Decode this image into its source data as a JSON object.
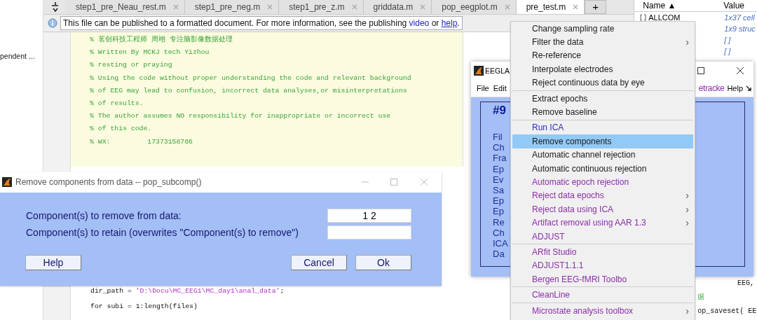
{
  "left_panel": {
    "item": "pendent ..."
  },
  "editor": {
    "tabs": [
      {
        "label": "step1_pre_Neau_rest.m",
        "selected": false
      },
      {
        "label": "step1_pre_neg.m",
        "selected": false
      },
      {
        "label": "step1_pre_z.m",
        "selected": false
      },
      {
        "label": "griddata.m",
        "selected": false
      },
      {
        "label": "pop_eegplot.m",
        "selected": false
      },
      {
        "label": "pre_test.m",
        "selected": true
      }
    ],
    "add_tab": "+",
    "info_bar": {
      "text": "This file can be published to a formatted document. For more information, see the publishing ",
      "link_1": "video",
      "middle": " or ",
      "link_2": "help",
      "end": "."
    },
    "comment_lines": [
      "% 茗创科技工程师 周翊 专注脑影像数据处理",
      "% Written By MCKJ tech Yizhou",
      "% resting or praying",
      "% Using the code without proper understanding the code and relevant background",
      "% of EEG may lead to confusion, incorrect data analyses,or misinterpretations",
      "% of results.",
      "% The author assumes NO responsibility for inappropriate or incorrect use",
      "% of this code.",
      "% WX:         17373158786"
    ],
    "code_lines": [
      {
        "text": "dir_path = ",
        "string": "'D:\\Docu\\MC_EEG1\\MC_day1\\anal_data'",
        "end": ";"
      },
      {
        "text": "for subi = 1:length(files)"
      }
    ]
  },
  "workspace": {
    "columns": [
      "Name ▲",
      "Value"
    ],
    "rows": [
      {
        "name": "ALLCOM",
        "value": "1x37 cell"
      },
      {
        "name": "",
        "value": "1x9 struc"
      },
      {
        "name": "",
        "value": "[ ]"
      },
      {
        "name": "",
        "value": "[ ]"
      }
    ]
  },
  "side_code": [
    "EEG,",
    "据",
    "op_saveset( EE"
  ],
  "eeglab": {
    "title": "EEGLA",
    "menus": [
      {
        "label": "File",
        "color": "#000000"
      },
      {
        "label": "Edit",
        "color": "#000000"
      },
      {
        "label": "etracke",
        "color": "#8b2fa8"
      },
      {
        "label": "Help",
        "color": "#000000"
      }
    ],
    "heading": "#9",
    "fields": [
      "Fil",
      "Ch",
      "Fra",
      "Ep",
      "Ev",
      "Sa",
      "Ep",
      "Ep",
      "Re",
      "Ch",
      "ICA",
      "Da"
    ]
  },
  "menu": [
    [
      {
        "label": "Change sampling rate",
        "color": "#1a1a1a",
        "submenu": false,
        "selected": false
      },
      {
        "label": "Filter the data",
        "color": "#1a1a1a",
        "submenu": true,
        "selected": false
      },
      {
        "label": "Re-reference",
        "color": "#1a1a1a",
        "submenu": false,
        "selected": false
      },
      {
        "label": "Interpolate electrodes",
        "color": "#1a1a1a",
        "submenu": false,
        "selected": false
      },
      {
        "label": "Reject continuous data by eye",
        "color": "#1a1a1a",
        "submenu": false,
        "selected": false
      }
    ],
    [
      {
        "label": "Extract epochs",
        "color": "#1a1a1a",
        "submenu": false,
        "selected": false
      },
      {
        "label": "Remove baseline",
        "color": "#1a1a1a",
        "submenu": false,
        "selected": false
      }
    ],
    [
      {
        "label": "Run ICA",
        "color": "#2b2bd0",
        "submenu": false,
        "selected": false
      },
      {
        "label": "Remove components",
        "color": "#1a1a1a",
        "submenu": false,
        "selected": true
      },
      {
        "label": "Automatic channel rejection",
        "color": "#1a1a1a",
        "submenu": false,
        "selected": false
      },
      {
        "label": "Automatic continuous rejection",
        "color": "#1a1a1a",
        "submenu": false,
        "selected": false
      },
      {
        "label": "Automatic epoch rejection",
        "color": "#8b2fa8",
        "submenu": false,
        "selected": false
      },
      {
        "label": "Reject data epochs",
        "color": "#8b2fa8",
        "submenu": true,
        "selected": false
      },
      {
        "label": "Reject data using ICA",
        "color": "#8b2fa8",
        "submenu": true,
        "selected": false
      },
      {
        "label": "Artifact removal using AAR 1.3",
        "color": "#8b2fa8",
        "submenu": true,
        "selected": false
      },
      {
        "label": "ADJUST",
        "color": "#8b2fa8",
        "submenu": false,
        "selected": false
      }
    ],
    [
      {
        "label": "ARfit Studio",
        "color": "#8b2fa8",
        "submenu": false,
        "selected": false
      },
      {
        "label": "ADJUST1.1.1",
        "color": "#8b2fa8",
        "submenu": false,
        "selected": false
      },
      {
        "label": "Bergen EEG-fMRI Toolbo",
        "color": "#8b2fa8",
        "submenu": false,
        "selected": false
      }
    ],
    [
      {
        "label": "CleanLine",
        "color": "#8b2fa8",
        "submenu": false,
        "selected": false
      }
    ],
    [
      {
        "label": "Microstate analysis toolbox",
        "color": "#8b2fa8",
        "submenu": true,
        "selected": false
      }
    ]
  ],
  "submenu_arrow": "›",
  "dialog": {
    "title": "Remove components from data -- pop_subcomp()",
    "rows": [
      {
        "label": "Component(s) to remove from data:",
        "value": "1 2"
      },
      {
        "label": "Component(s) to retain (overwrites \"Component(s) to remove\")",
        "value": ""
      }
    ],
    "buttons": [
      "Help",
      "Cancel",
      "Ok"
    ]
  }
}
